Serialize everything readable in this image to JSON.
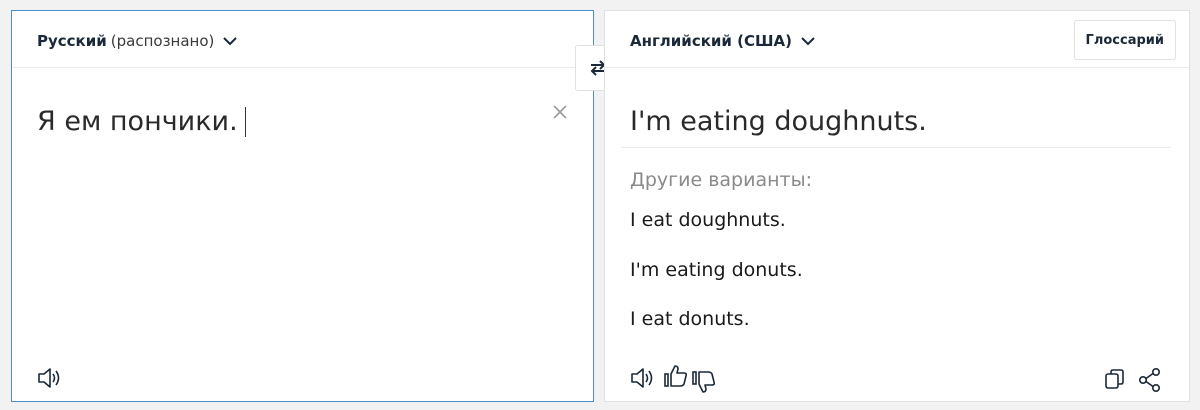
{
  "source": {
    "language_name": "Русский",
    "language_note": "(распознано)",
    "text": "Я ем пончики."
  },
  "target": {
    "language_name": "Английский (США)",
    "glossary_label": "Глоссарий",
    "translation": "I'm eating doughnuts.",
    "alternatives_label": "Другие варианты:",
    "alternatives": [
      "I eat doughnuts.",
      "I'm eating donuts.",
      "I eat donuts."
    ]
  },
  "icons": {
    "chevron": "chevron-down-icon",
    "clear": "close-icon",
    "swap": "swap-arrows-icon",
    "speaker": "speaker-icon",
    "like": "thumbs-up-icon",
    "dislike": "thumbs-down-icon",
    "copy": "copy-icon",
    "share": "share-icon"
  },
  "colors": {
    "active_border": "#4a90c8",
    "icon_dark": "#1b2838"
  }
}
